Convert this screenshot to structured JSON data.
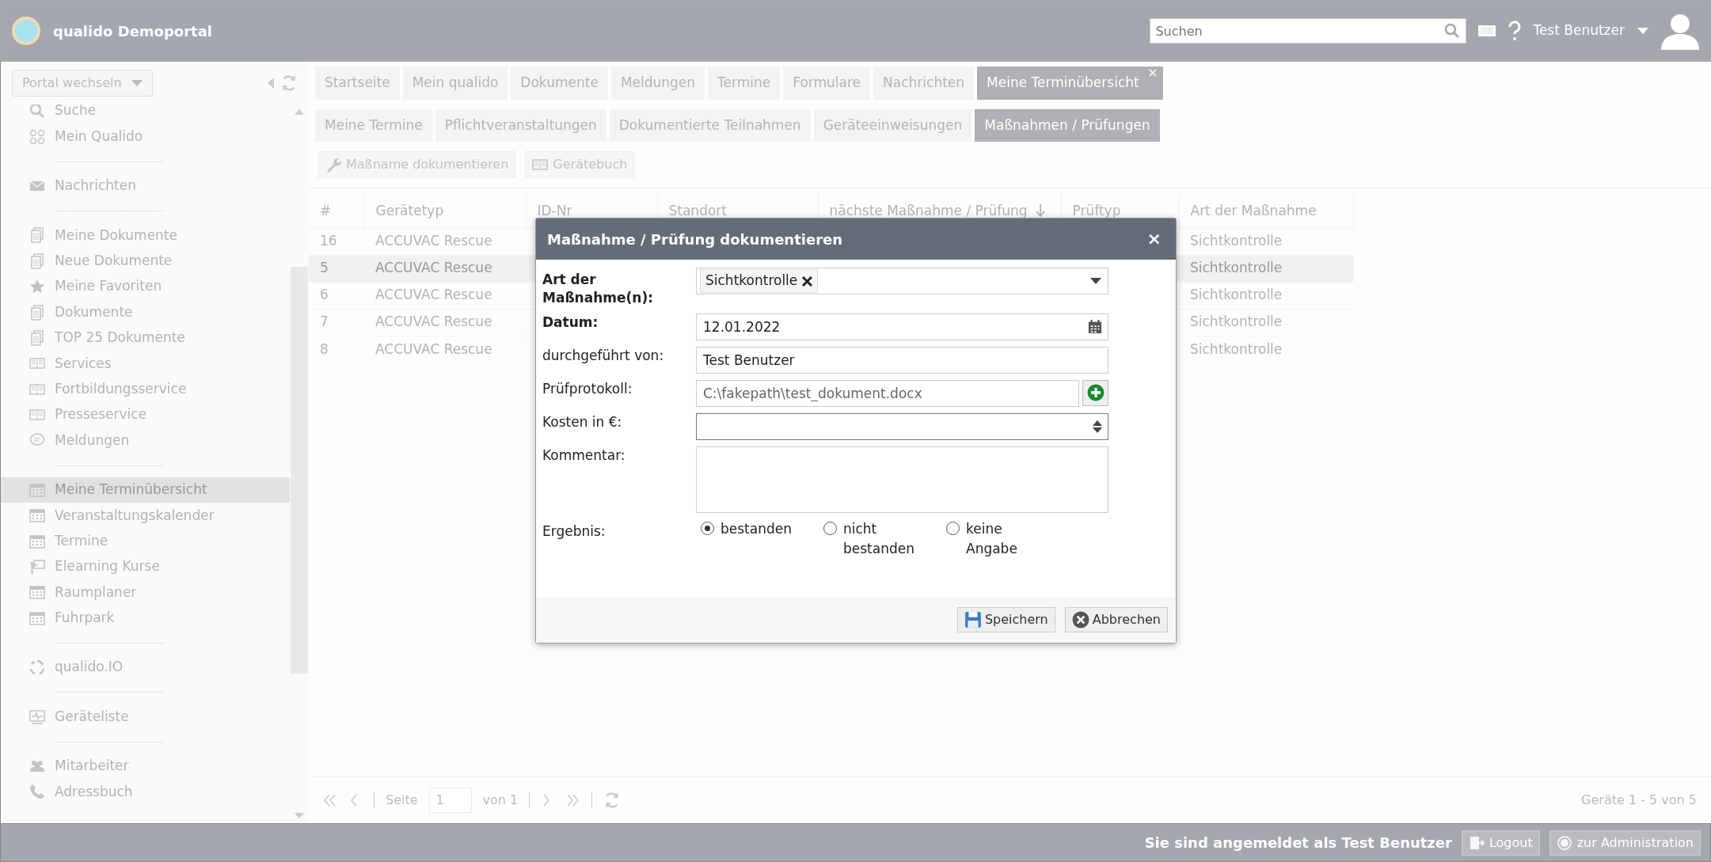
{
  "header": {
    "title": "qualido Demoportal",
    "search": {
      "placeholder": "Suchen"
    },
    "user": "Test Benutzer"
  },
  "sidebar": {
    "portal_switch": "Portal wechseln",
    "groups": [
      [
        {
          "label": "Suche",
          "kind": "search",
          "selected": false
        },
        {
          "label": "Mein Qualido",
          "kind": "apps",
          "selected": false
        }
      ],
      [
        {
          "label": "Nachrichten",
          "kind": "mail",
          "selected": false
        }
      ],
      [
        {
          "label": "Meine Dokumente",
          "kind": "docs",
          "selected": false
        },
        {
          "label": "Neue Dokumente",
          "kind": "docs",
          "selected": false
        },
        {
          "label": "Meine Favoriten",
          "kind": "star",
          "selected": false
        },
        {
          "label": "Dokumente",
          "kind": "docs",
          "selected": false
        },
        {
          "label": "TOP 25 Dokumente",
          "kind": "docs",
          "selected": false
        },
        {
          "label": "Services",
          "kind": "book",
          "selected": false
        },
        {
          "label": "Fortbildungsservice",
          "kind": "book",
          "selected": false
        },
        {
          "label": "Presseservice",
          "kind": "book",
          "selected": false
        },
        {
          "label": "Meldungen",
          "kind": "chat",
          "selected": false
        }
      ],
      [
        {
          "label": "Meine Terminübersicht",
          "kind": "calendar",
          "selected": true
        },
        {
          "label": "Veranstaltungskalender",
          "kind": "calendar",
          "selected": false
        },
        {
          "label": "Termine",
          "kind": "calendar",
          "selected": false
        },
        {
          "label": "Elearning Kurse",
          "kind": "board",
          "selected": false
        },
        {
          "label": "Raumplaner",
          "kind": "calendar",
          "selected": false
        },
        {
          "label": "Fuhrpark",
          "kind": "calendar",
          "selected": false
        }
      ],
      [
        {
          "label": "qualido.IO",
          "kind": "cycle",
          "selected": false
        }
      ],
      [
        {
          "label": "Geräteliste",
          "kind": "monitor",
          "selected": false
        }
      ],
      [
        {
          "label": "Mitarbeiter",
          "kind": "people",
          "selected": false
        },
        {
          "label": "Adressbuch",
          "kind": "phone",
          "selected": false
        }
      ]
    ]
  },
  "main_tabs": [
    {
      "label": "Startseite",
      "selected": false
    },
    {
      "label": "Mein qualido",
      "selected": false
    },
    {
      "label": "Dokumente",
      "selected": false
    },
    {
      "label": "Meldungen",
      "selected": false
    },
    {
      "label": "Termine",
      "selected": false
    },
    {
      "label": "Formulare",
      "selected": false
    },
    {
      "label": "Nachrichten",
      "selected": false
    },
    {
      "label": "Meine Terminübersicht",
      "selected": true,
      "close_mark": "×"
    }
  ],
  "sub_tabs": [
    {
      "label": "Meine Termine",
      "selected": false
    },
    {
      "label": "Pflichtveranstaltungen",
      "selected": false
    },
    {
      "label": "Dokumentierte Teilnahmen",
      "selected": false
    },
    {
      "label": "Geräteeinweisungen",
      "selected": false
    },
    {
      "label": "Maßnahmen / Prüfungen",
      "selected": true
    }
  ],
  "toolbar": [
    {
      "label": "Maßname dokumentieren",
      "kind": "wrench"
    },
    {
      "label": "Gerätebuch",
      "kind": "book"
    }
  ],
  "table": {
    "columns": [
      {
        "label": "#",
        "sorted": false
      },
      {
        "label": "Gerätetyp",
        "sorted": false
      },
      {
        "label": "ID-Nr",
        "sorted": false
      },
      {
        "label": "Standort",
        "sorted": false
      },
      {
        "label": "nächste Maßnahme / Prüfung",
        "sorted": true
      },
      {
        "label": "Prüftyp",
        "sorted": false
      },
      {
        "label": "Art der Maßnahme",
        "sorted": false
      }
    ],
    "rows": [
      {
        "number": "16",
        "device_type": "ACCUVAC Rescue",
        "measure_type": "Sichtkontrolle",
        "selected": false
      },
      {
        "number": "5",
        "device_type": "ACCUVAC Rescue",
        "measure_type": "Sichtkontrolle",
        "selected": true
      },
      {
        "number": "6",
        "device_type": "ACCUVAC Rescue",
        "measure_type": "Sichtkontrolle",
        "selected": false
      },
      {
        "number": "7",
        "device_type": "ACCUVAC Rescue",
        "measure_type": "Sichtkontrolle",
        "selected": false
      },
      {
        "number": "8",
        "device_type": "ACCUVAC Rescue",
        "measure_type": "Sichtkontrolle",
        "selected": false
      }
    ]
  },
  "pager": {
    "page_label": "Seite",
    "page": "1",
    "of": "von 1",
    "summary": "Geräte 1 - 5 von 5"
  },
  "status_bar": {
    "text": "Sie sind angemeldet als Test Benutzer",
    "buttons": [
      {
        "label": "Logout",
        "kind": "door"
      },
      {
        "label": "zur Administration",
        "kind": "logo"
      }
    ]
  },
  "dialog": {
    "title": "Maßnahme / Prüfung dokumentieren",
    "close_mark": "×",
    "fields": [
      {
        "kind": "tags",
        "label": "Art der Maßnahme(n):",
        "required": true,
        "tags": [
          "Sichtkontrolle"
        ]
      },
      {
        "kind": "date",
        "label": "Datum:",
        "required": true,
        "value": "12.01.2022"
      },
      {
        "kind": "text",
        "label": "durchgeführt von:",
        "required": false,
        "value": "Test Benutzer"
      },
      {
        "kind": "file",
        "label": "Prüfprotokoll:",
        "required": false,
        "value": "C:\\fakepath\\test_dokument.docx"
      },
      {
        "kind": "number",
        "label": "Kosten in €:",
        "required": false
      },
      {
        "kind": "textarea",
        "label": "Kommentar:",
        "required": false
      },
      {
        "kind": "radio",
        "label": "Ergebnis:",
        "required": false,
        "options": [
          {
            "label": "bestanden",
            "selected": true
          },
          {
            "label": "nicht bestanden",
            "selected": false
          },
          {
            "label": "keine Angabe",
            "selected": false
          }
        ]
      }
    ],
    "buttons": [
      {
        "label": "Speichern",
        "kind": "save"
      },
      {
        "label": "Abbrechen",
        "kind": "cancel"
      }
    ]
  }
}
